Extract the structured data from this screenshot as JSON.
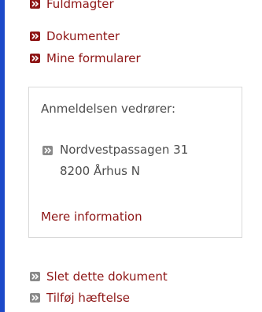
{
  "nav": {
    "items": [
      {
        "label": "Fuldmagter"
      },
      {
        "label": "Dokumenter"
      },
      {
        "label": "Mine formularer"
      }
    ]
  },
  "info_box": {
    "heading": "Anmeldelsen vedrører:",
    "address_line1": "Nordvestpassagen 31",
    "address_line2": "8200 Århus N",
    "more_link": "Mere information"
  },
  "actions": {
    "items": [
      {
        "label": "Slet dette dokument"
      },
      {
        "label": "Tilføj hæftelse"
      }
    ]
  },
  "colors": {
    "link": "#8e1616",
    "accent_bar": "#1c49c9",
    "bullet_red": "#8e1616",
    "bullet_grey": "#8a8a8a"
  }
}
